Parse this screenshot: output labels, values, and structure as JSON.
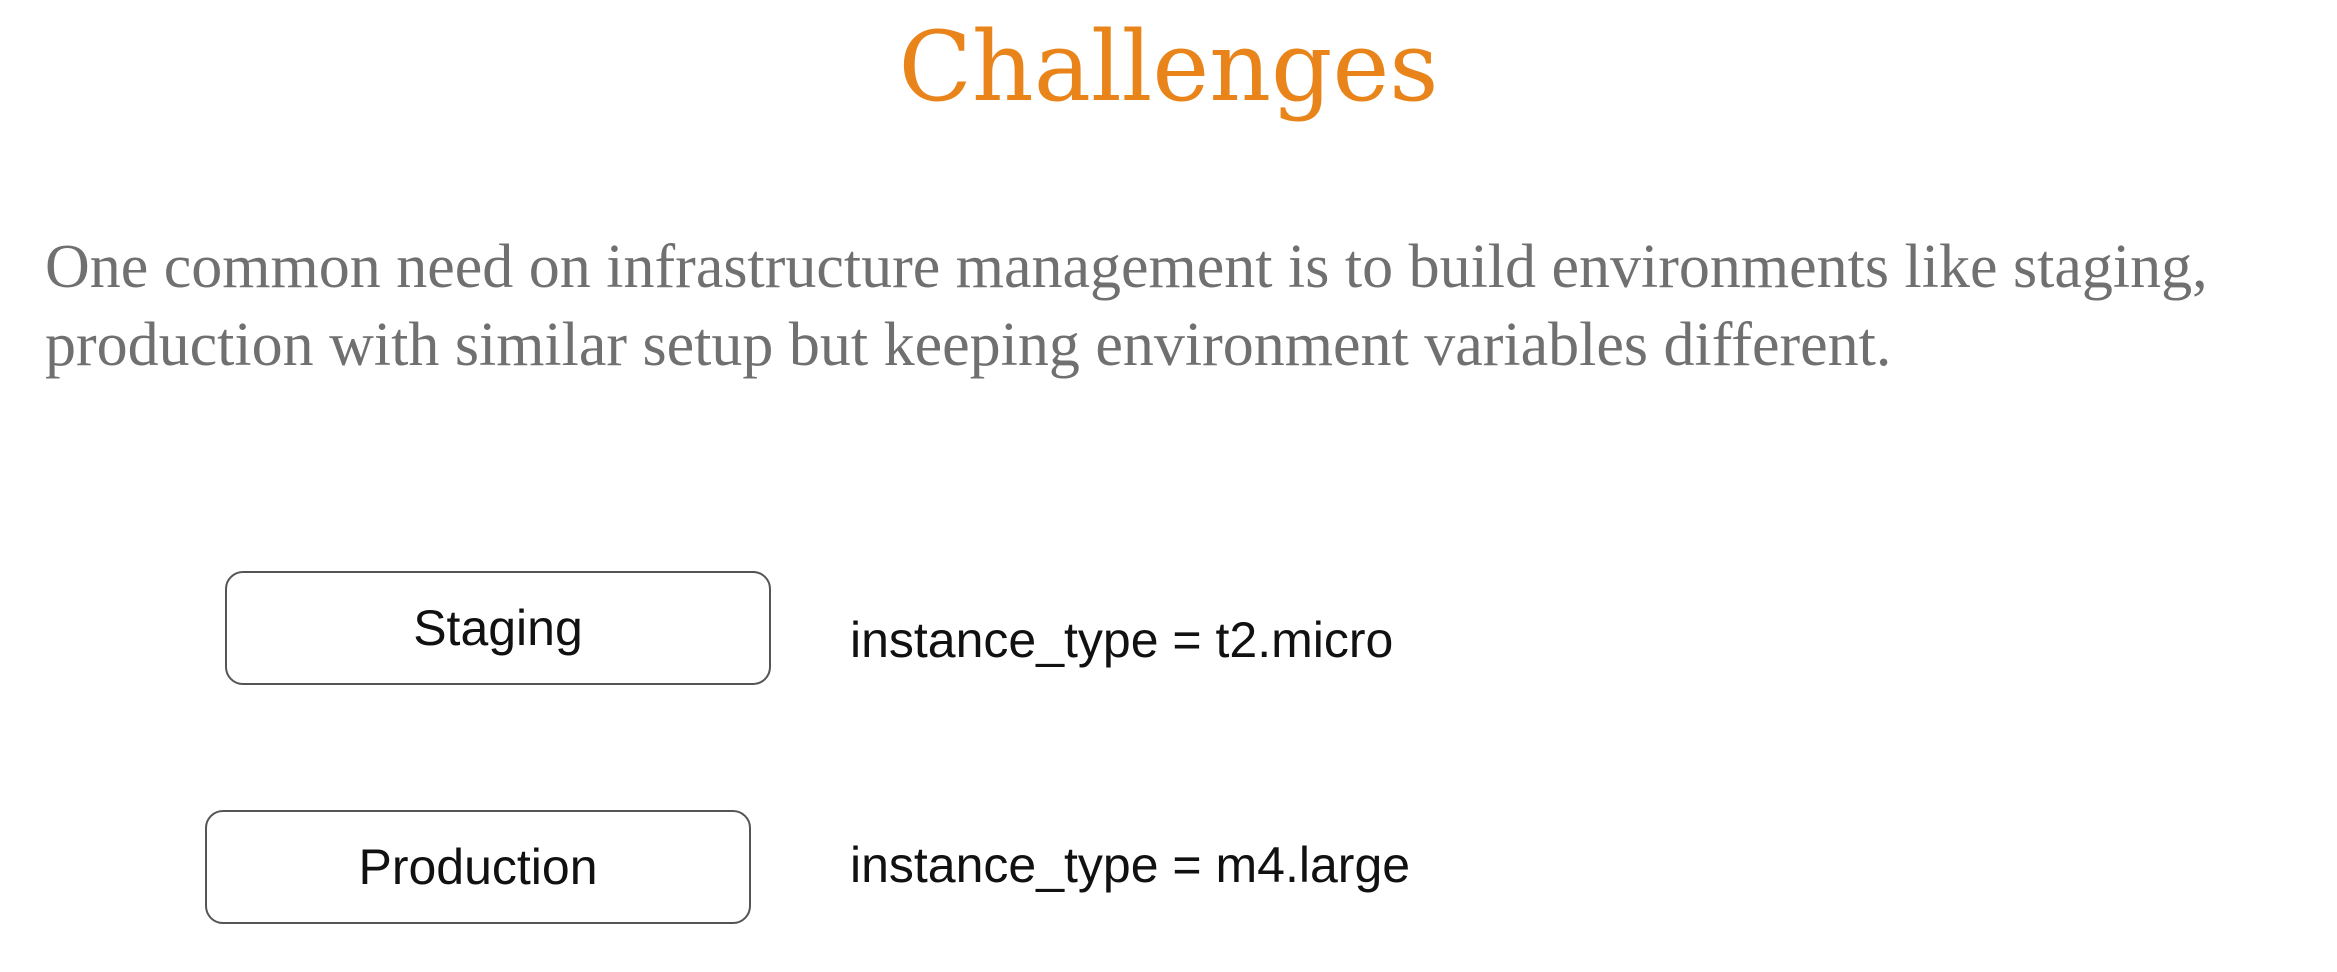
{
  "slide": {
    "title": "Challenges",
    "description_line1": "One common need on infrastructure management is to build environments like staging,",
    "description_line2": "production with similar setup but keeping environment variables different."
  },
  "environments": [
    {
      "name": "Staging",
      "variable": "instance_type = t2.micro"
    },
    {
      "name": "Production",
      "variable": "instance_type = m4.large"
    }
  ],
  "colors": {
    "title": "#E8841A",
    "body_text": "#707070",
    "box_border": "#555555",
    "label_text": "#111111"
  }
}
